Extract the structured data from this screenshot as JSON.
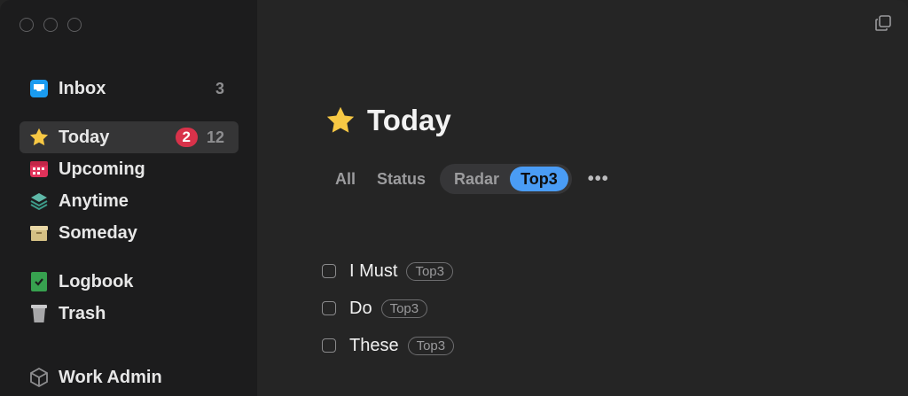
{
  "sidebar": {
    "items": [
      {
        "label": "Inbox",
        "count": "3",
        "icon": "inbox-icon"
      },
      {
        "label": "Today",
        "badge": "2",
        "count": "12",
        "icon": "star-icon"
      },
      {
        "label": "Upcoming",
        "icon": "calendar-icon"
      },
      {
        "label": "Anytime",
        "icon": "layers-icon"
      },
      {
        "label": "Someday",
        "icon": "archive-box-icon"
      },
      {
        "label": "Logbook",
        "icon": "logbook-icon"
      },
      {
        "label": "Trash",
        "icon": "trash-icon"
      },
      {
        "label": "Work Admin",
        "icon": "cube-icon"
      }
    ]
  },
  "main": {
    "title": "Today",
    "tabs": [
      "All",
      "Status",
      "Radar",
      "Top3"
    ],
    "selected_tab": "Top3",
    "more_label": "•••",
    "tasks": [
      {
        "title": "I Must",
        "tag": "Top3"
      },
      {
        "title": "Do",
        "tag": "Top3"
      },
      {
        "title": "These",
        "tag": "Top3"
      }
    ]
  },
  "colors": {
    "accent": "#4a9cf5",
    "badge": "#d8324a",
    "sidebar_bg": "#1c1c1d",
    "main_bg": "#252525"
  }
}
